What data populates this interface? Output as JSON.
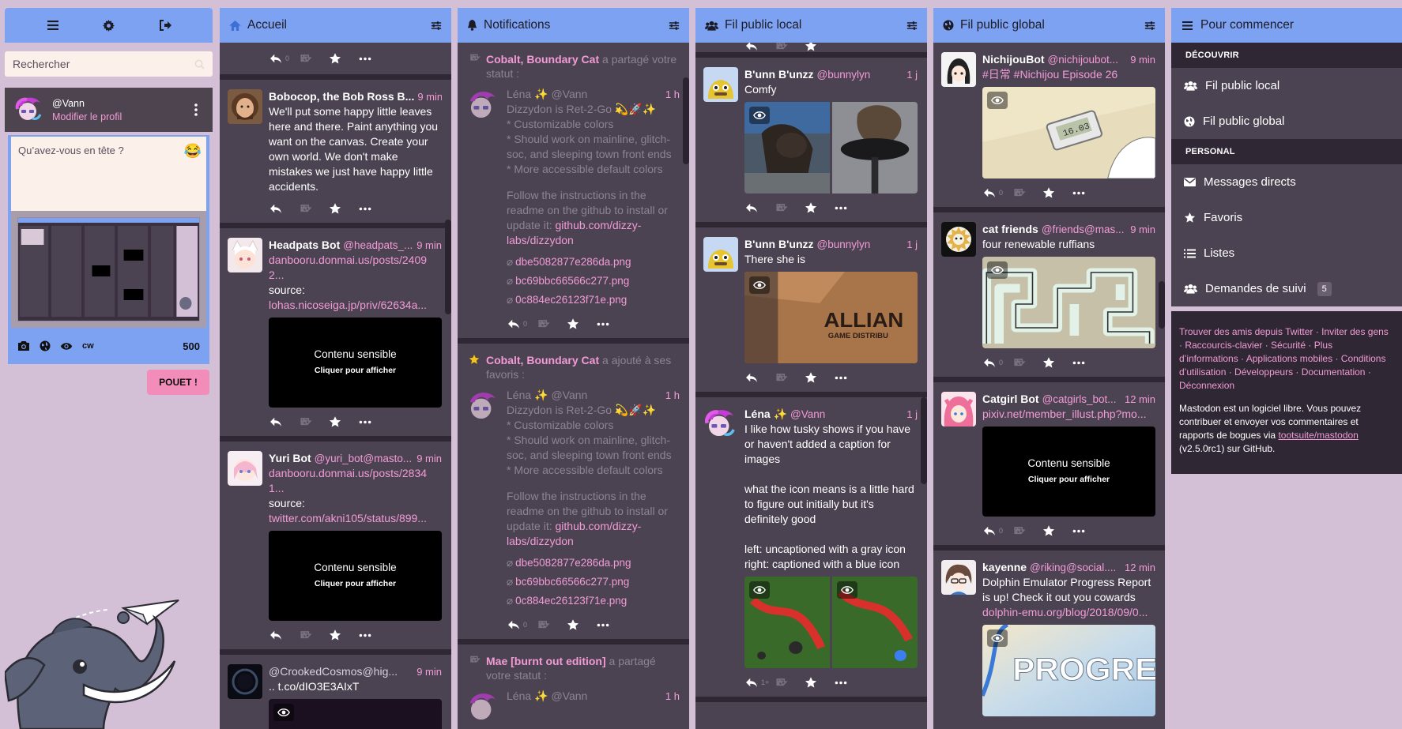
{
  "drawer": {
    "search_placeholder": "Rechercher",
    "account": {
      "acct": "@Vann",
      "edit": "Modifier le profil"
    },
    "compose_placeholder": "Qu’avez-vous en tête ?",
    "cw_label": "cw",
    "char_count": "500",
    "toot_button": "POUET !"
  },
  "columns": {
    "home": {
      "title": "Accueil",
      "statuses": [
        {
          "display_name": "Bobocop, the Bob Ross B...",
          "time": "9 min",
          "text": "We'll put some happy little leaves here and there. Paint anything you want on the canvas. Create your own world. We don't make mistakes we just have happy little accidents."
        },
        {
          "display_name": "Headpats Bot",
          "username": "@headpats_...",
          "time": "9 min",
          "link1": "danbooru.donmai.us/posts/24092...",
          "source_label": "source:",
          "link2": "lohas.nicoseiga.jp/priv/62634a...",
          "sensitive_title": "Contenu sensible",
          "sensitive_hint": "Cliquer pour afficher"
        },
        {
          "display_name": "Yuri Bot",
          "username": "@yuri_bot@masto...",
          "time": "9 min",
          "link1": "danbooru.donmai.us/posts/28341...",
          "source_label": "source:",
          "link2": "twitter.com/akni105/status/899...",
          "sensitive_title": "Contenu sensible",
          "sensitive_hint": "Cliquer pour afficher"
        },
        {
          "display_name": "@CrookedCosmos@hig...",
          "time": "9 min",
          "text": ".. t.co/dIO3E3AIxT"
        }
      ]
    },
    "notifications": {
      "title": "Notifications",
      "items": [
        {
          "actor": "Cobalt, Boundary Cat",
          "action": "a partagé votre statut :",
          "author": "Léna ✨",
          "author_handle": "@Vann",
          "time": "1 h",
          "line1": "Dizzydon is Ret-2-Go 💫🚀✨",
          "lines": [
            "* Customizable colors",
            "* Should work on mainline, glitch-soc, and sleeping town front ends",
            "* More accessible default colors"
          ],
          "para": "Follow the instructions in the readme on the github to install or update it:",
          "link": "github.com/dizzy-labs/dizzydon",
          "files": [
            "dbe5082877e286da.png",
            "bc69bbc66566c277.png",
            "0c884ec26123f71e.png"
          ]
        },
        {
          "actor": "Cobalt, Boundary Cat",
          "action": "a ajouté à ses favoris :",
          "author": "Léna ✨",
          "author_handle": "@Vann",
          "time": "1 h",
          "line1": "Dizzydon is Ret-2-Go 💫🚀✨",
          "lines": [
            "* Customizable colors",
            "* Should work on mainline, glitch-soc, and sleeping town front ends",
            "* More accessible default colors"
          ],
          "para": "Follow the instructions in the readme on the github to install or update it:",
          "link": "github.com/dizzy-labs/dizzydon",
          "files": [
            "dbe5082877e286da.png",
            "bc69bbc66566c277.png",
            "0c884ec26123f71e.png"
          ]
        },
        {
          "actor": "Mae [burnt out edition]",
          "action": "a partagé votre statut :",
          "author": "Léna ✨",
          "author_handle": "@Vann",
          "time": "1 h"
        }
      ]
    },
    "local": {
      "title": "Fil public local",
      "statuses": [
        {
          "display_name": "B'unn B'unzz",
          "username": "@bunnylyn",
          "time": "1 j",
          "text": "Comfy"
        },
        {
          "display_name": "B'unn B'unzz",
          "username": "@bunnylyn",
          "time": "1 j",
          "text": "There she is",
          "box_text1": "ALLIAN",
          "box_text2": "GAME DISTRIBU"
        },
        {
          "display_name": "Léna ✨",
          "username": "@Vann",
          "time": "1 j",
          "p1": "I like how tusky shows if you have or haven't added a caption for images",
          "p2": "what the icon means is a little hard to figure out initially but it's definitely good",
          "p3": "left: uncaptioned with a gray icon",
          "p4": "right: captioned with a blue icon",
          "reply_count": "1+"
        }
      ]
    },
    "global": {
      "title": "Fil public global",
      "statuses": [
        {
          "display_name": "NichijouBot",
          "username": "@nichijoubot...",
          "time": "9 min",
          "text": "#日常 #Nichijou Episode 26",
          "scale": "16.03"
        },
        {
          "display_name": "cat friends",
          "username": "@friends@mas...",
          "time": "9 min",
          "text": "four renewable ruffians"
        },
        {
          "display_name": "Catgirl Bot",
          "username": "@catgirls_bot...",
          "time": "12 min",
          "link": "pixiv.net/member_illust.php?mo...",
          "sensitive_title": "Contenu sensible",
          "sensitive_hint": "Cliquer pour afficher"
        },
        {
          "display_name": "kayenne",
          "username": "@riking@social....",
          "time": "12 min",
          "text": "Dolphin Emulator Progress Report is up! Check it out you cowards",
          "link": "dolphin-emu.org/blog/2018/09/0...",
          "image_text": "PROGRESS"
        }
      ]
    }
  },
  "getting_started": {
    "title": "Pour commencer",
    "discover_label": "DÉCOUVRIR",
    "local": "Fil public local",
    "global": "Fil public global",
    "personal_label": "PERSONAL",
    "dm": "Messages directs",
    "favs": "Favoris",
    "lists": "Listes",
    "follow_requests": "Demandes de suivi",
    "follow_requests_count": "5",
    "links": [
      "Trouver des amis depuis Twitter",
      "Inviter des gens",
      "Raccourcis-clavier",
      "Sécurité",
      "Plus d’informations",
      "Applications mobiles",
      "Conditions d’utilisation",
      "Développeurs",
      "Documentation",
      "Déconnexion"
    ],
    "about_text": "Mastodon est un logiciel libre. Vous pouvez contribuer et envoyer vos commentaires et rapports de bogues via",
    "about_link": "tootsuite/mastodon",
    "about_version": "(v2.5.0rc1) sur GitHub."
  },
  "colors": {
    "accent": "#7ea2f2",
    "link": "#f29bd6",
    "bg": "#d3bfd6",
    "column": "#4c4352",
    "separator": "#2f2734"
  },
  "icons": [
    "menu-icon",
    "gear-icon",
    "logout-icon",
    "home-icon",
    "bell-icon",
    "users-icon",
    "globe-icon",
    "sliders-icon",
    "reply-icon",
    "boost-icon",
    "star-icon",
    "more-icon",
    "camera-icon",
    "eye-icon"
  ]
}
